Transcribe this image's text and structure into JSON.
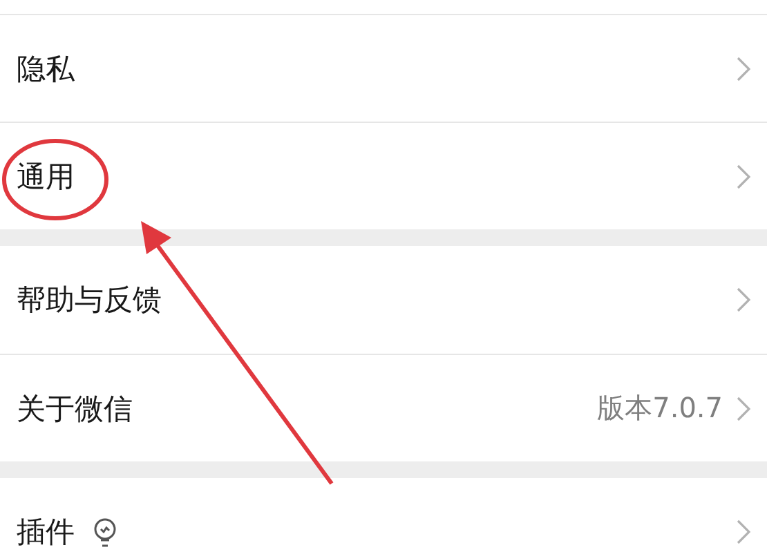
{
  "sections": [
    {
      "rows": [
        {
          "label": "隐私",
          "kind": "plain"
        },
        {
          "label": "通用",
          "kind": "plain"
        }
      ]
    },
    {
      "rows": [
        {
          "label": "帮助与反馈",
          "kind": "plain"
        },
        {
          "label": "关于微信",
          "kind": "value",
          "value": "版本7.0.7"
        }
      ]
    },
    {
      "rows": [
        {
          "label": "插件",
          "kind": "bulb"
        }
      ]
    }
  ]
}
